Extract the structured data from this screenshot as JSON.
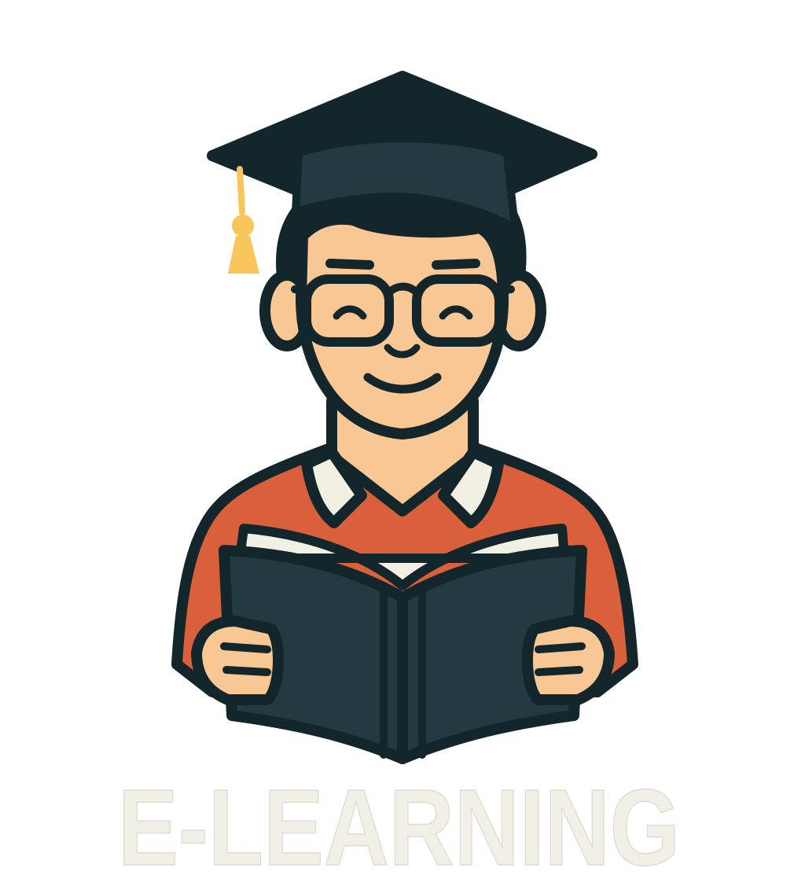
{
  "logo": {
    "title": "E-LEARNING",
    "colors": {
      "outline": "#13262b",
      "cap": "#243a42",
      "tassel": "#f9c45a",
      "skin": "#f9c794",
      "shirt": "#d9603a",
      "collar": "#f2efe3",
      "book": "#243a42",
      "pages": "#f2efe3",
      "text": "#f1efe6"
    }
  }
}
